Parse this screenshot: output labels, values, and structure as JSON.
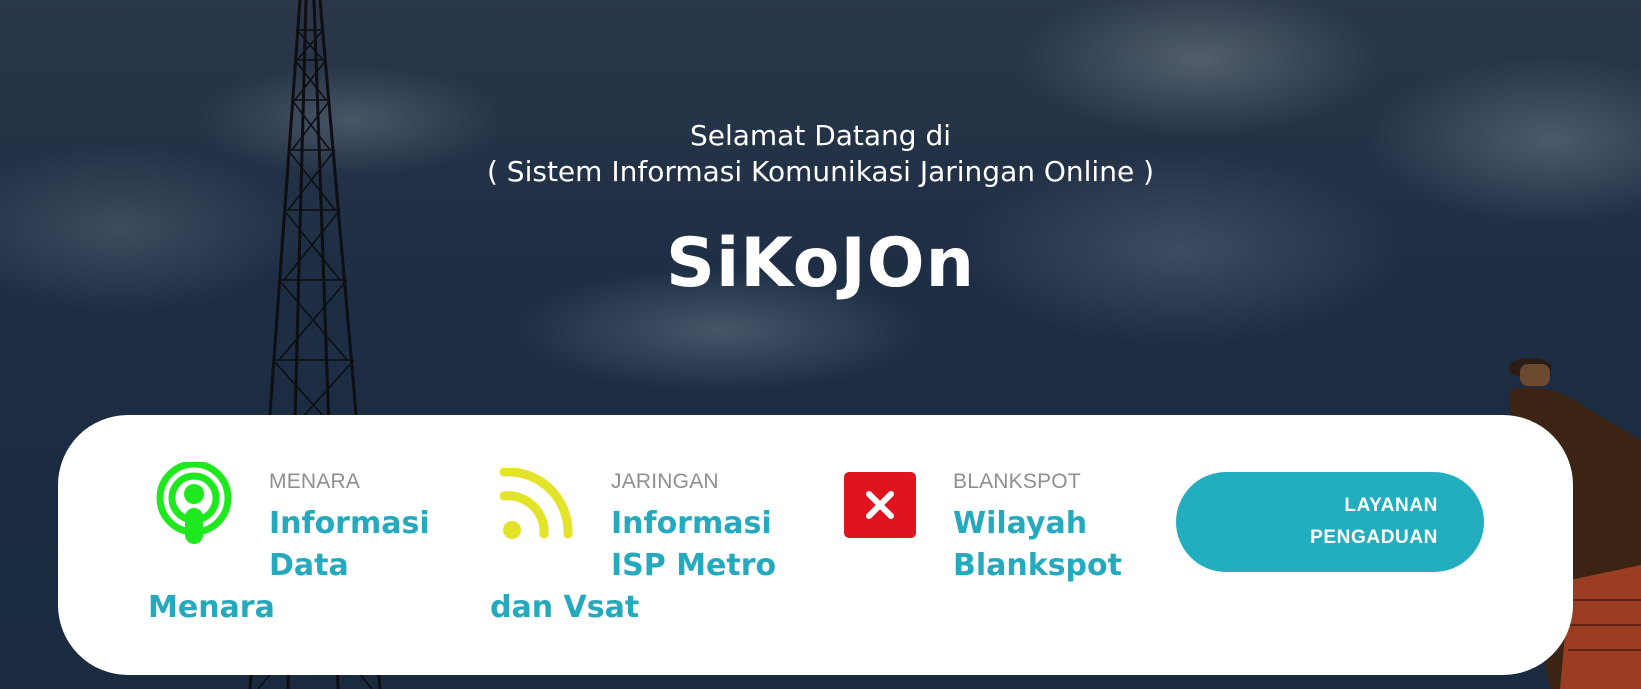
{
  "hero": {
    "welcome_line1": "Selamat Datang di",
    "welcome_line2": "( Sistem Informasi Komunikasi Jaringan Online )",
    "brand": "SiKoJOn"
  },
  "features": [
    {
      "kicker": "MENARA",
      "title_line1": "Informasi",
      "title_line2": "Data",
      "title_line3": "Menara",
      "icon": "podcast-icon",
      "icon_color": "#1ee81e"
    },
    {
      "kicker": "JARINGAN",
      "title_line1": "Informasi",
      "title_line2": "ISP Metro",
      "title_line3": "dan Vsat",
      "icon": "rss-icon",
      "icon_color": "#e3e42a"
    },
    {
      "kicker": "BLANKSPOT",
      "title_line1": "Wilayah",
      "title_line2": "Blankspot",
      "icon": "close-box-icon",
      "icon_color": "#e0141e"
    }
  ],
  "cta": {
    "line1": "LAYANAN",
    "line2": "PENGADUAN"
  },
  "colors": {
    "accent": "#22aebe",
    "title_teal": "#24a9be",
    "kicker_gray": "#8f8f8f"
  }
}
